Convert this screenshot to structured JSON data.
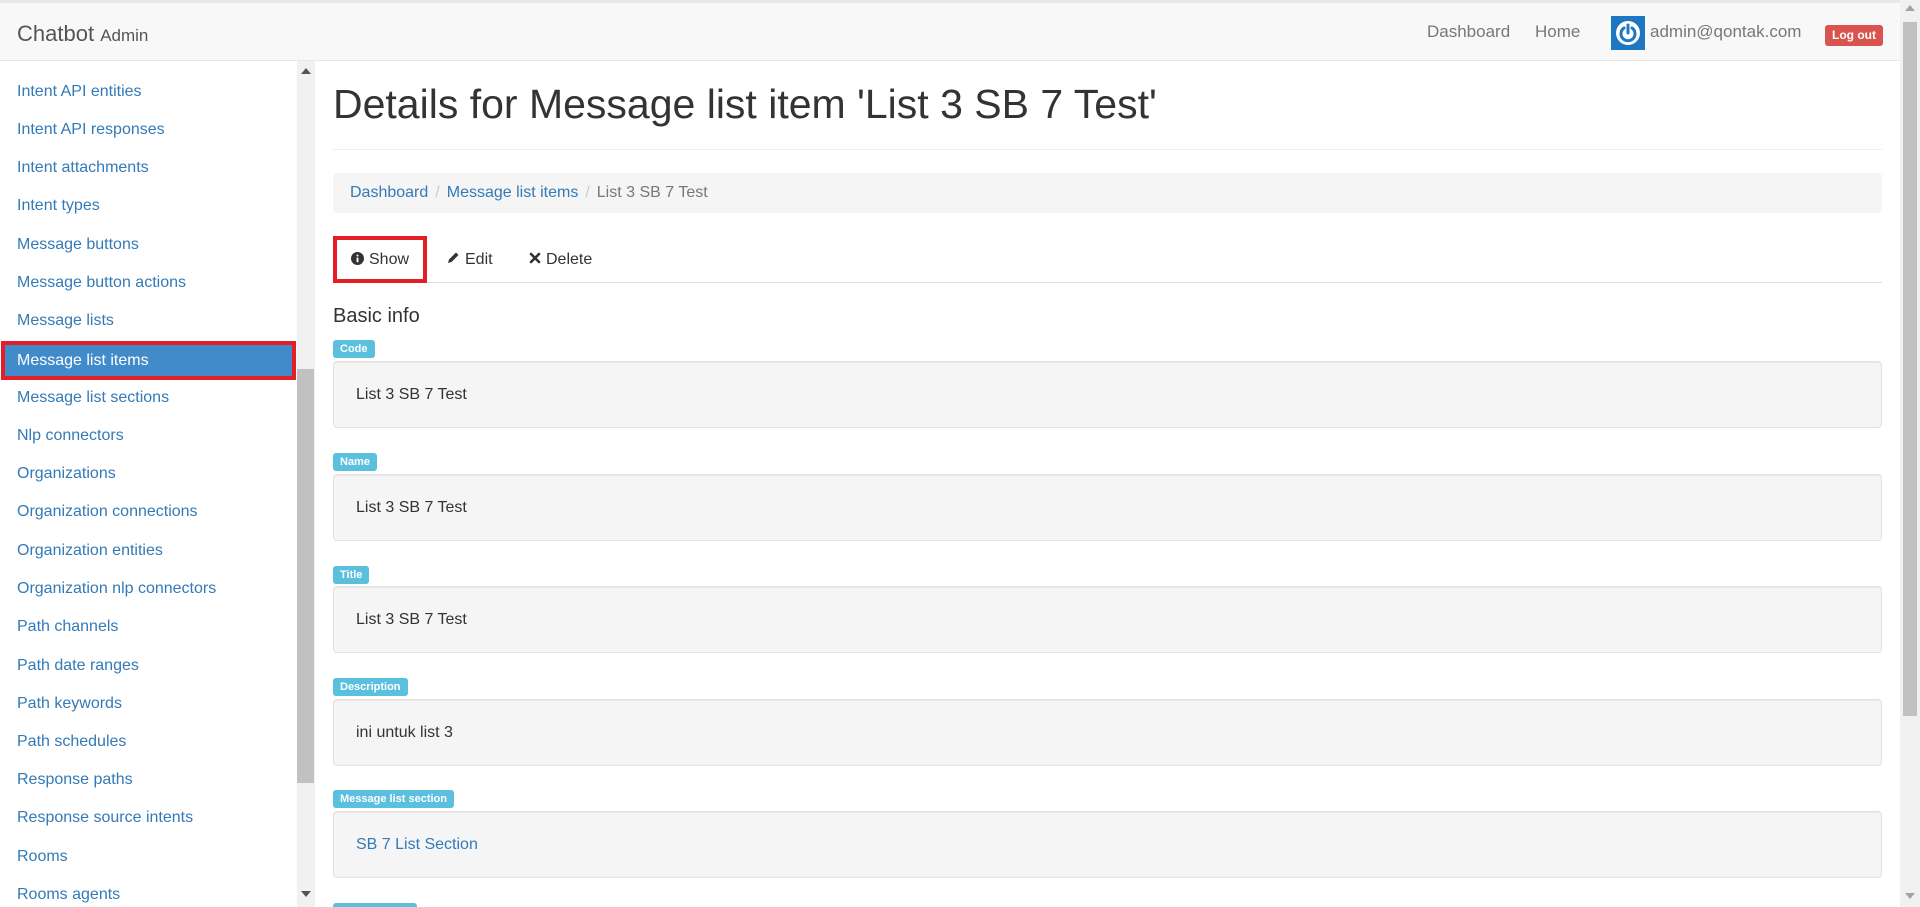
{
  "navbar": {
    "brand": "Chatbot",
    "brand_sub": "Admin",
    "links": [
      "Dashboard",
      "Home"
    ],
    "user_email": "admin@qontak.com",
    "logout_label": "Log out"
  },
  "sidebar": {
    "cut_label": "Intent ...",
    "items": [
      "Intent API entities",
      "Intent API responses",
      "Intent attachments",
      "Intent types",
      "Message buttons",
      "Message button actions",
      "Message lists",
      "Message list items",
      "Message list sections",
      "Nlp connectors",
      "Organizations",
      "Organization connections",
      "Organization entities",
      "Organization nlp connectors",
      "Path channels",
      "Path date ranges",
      "Path keywords",
      "Path schedules",
      "Response paths",
      "Response source intents",
      "Rooms",
      "Rooms agents"
    ],
    "active_item": "Message list items"
  },
  "main": {
    "title": "Details for Message list item 'List 3 SB 7 Test'",
    "breadcrumb": [
      "Dashboard",
      "Message list items",
      "List 3 SB 7 Test"
    ],
    "tabs": {
      "show": "Show",
      "edit": "Edit",
      "delete": "Delete"
    },
    "section_title": "Basic info",
    "fields": [
      {
        "label": "Code",
        "value": "List 3 SB 7 Test"
      },
      {
        "label": "Name",
        "value": "List 3 SB 7 Test"
      },
      {
        "label": "Title",
        "value": "List 3 SB 7 Test"
      },
      {
        "label": "Description",
        "value": "ini untuk list 3"
      },
      {
        "label": "Message list section",
        "value": "SB 7 List Section"
      }
    ]
  },
  "colors": {
    "link": "#337ab7",
    "active_bg": "#428bca",
    "highlight_border": "#e31e25",
    "label_bg": "#5bc0de",
    "logout_bg": "#d9534f"
  }
}
